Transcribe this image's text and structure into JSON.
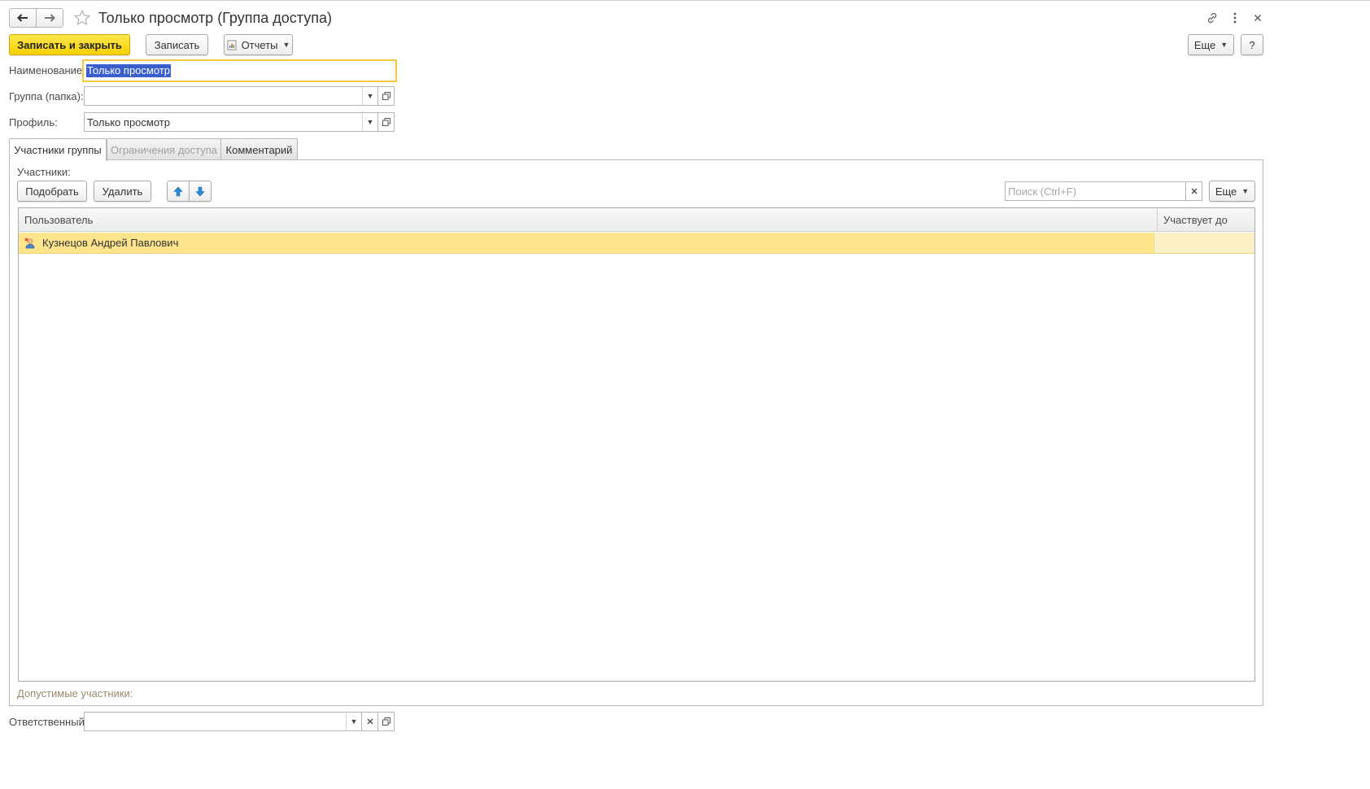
{
  "window": {
    "title": "Только просмотр (Группа доступа)"
  },
  "toolbar": {
    "save_close_label": "Записать и закрыть",
    "save_label": "Записать",
    "reports_label": "Отчеты",
    "more_label": "Еще",
    "help_label": "?"
  },
  "form": {
    "name_label": "Наименование:",
    "name_value": "Только просмотр",
    "group_label": "Группа (папка):",
    "group_value": "",
    "profile_label": "Профиль:",
    "profile_value": "Только просмотр",
    "responsible_label": "Ответственный:",
    "responsible_value": ""
  },
  "tabs": [
    {
      "label": "Участники группы",
      "state": "active"
    },
    {
      "label": "Ограничения доступа",
      "state": "disabled"
    },
    {
      "label": "Комментарий",
      "state": "normal"
    }
  ],
  "members": {
    "section_label": "Участники:",
    "pick_label": "Подобрать",
    "delete_label": "Удалить",
    "search_placeholder": "Поиск (Ctrl+F)",
    "more_label": "Еще",
    "columns": [
      "Пользователь",
      "Участвует до"
    ],
    "rows": [
      {
        "user": "Кузнецов Андрей Павлович",
        "until": ""
      }
    ],
    "allowed_label": "Допустимые участники:"
  },
  "icons": {
    "back": "arrow-left-icon",
    "forward": "arrow-right-icon",
    "favorite": "star-icon",
    "link": "link-icon",
    "menu": "vertical-dots-icon",
    "close": "close-icon",
    "reports": "report-icon",
    "user": "user-icon",
    "move_up": "arrow-up-icon",
    "move_down": "arrow-down-icon"
  },
  "colors": {
    "primary_button": "#f6d000",
    "selected_row": "#fde58d",
    "focus_border": "#f5c842",
    "selection_highlight": "#3a5fcd",
    "arrow_blue": "#2a8ad4"
  }
}
